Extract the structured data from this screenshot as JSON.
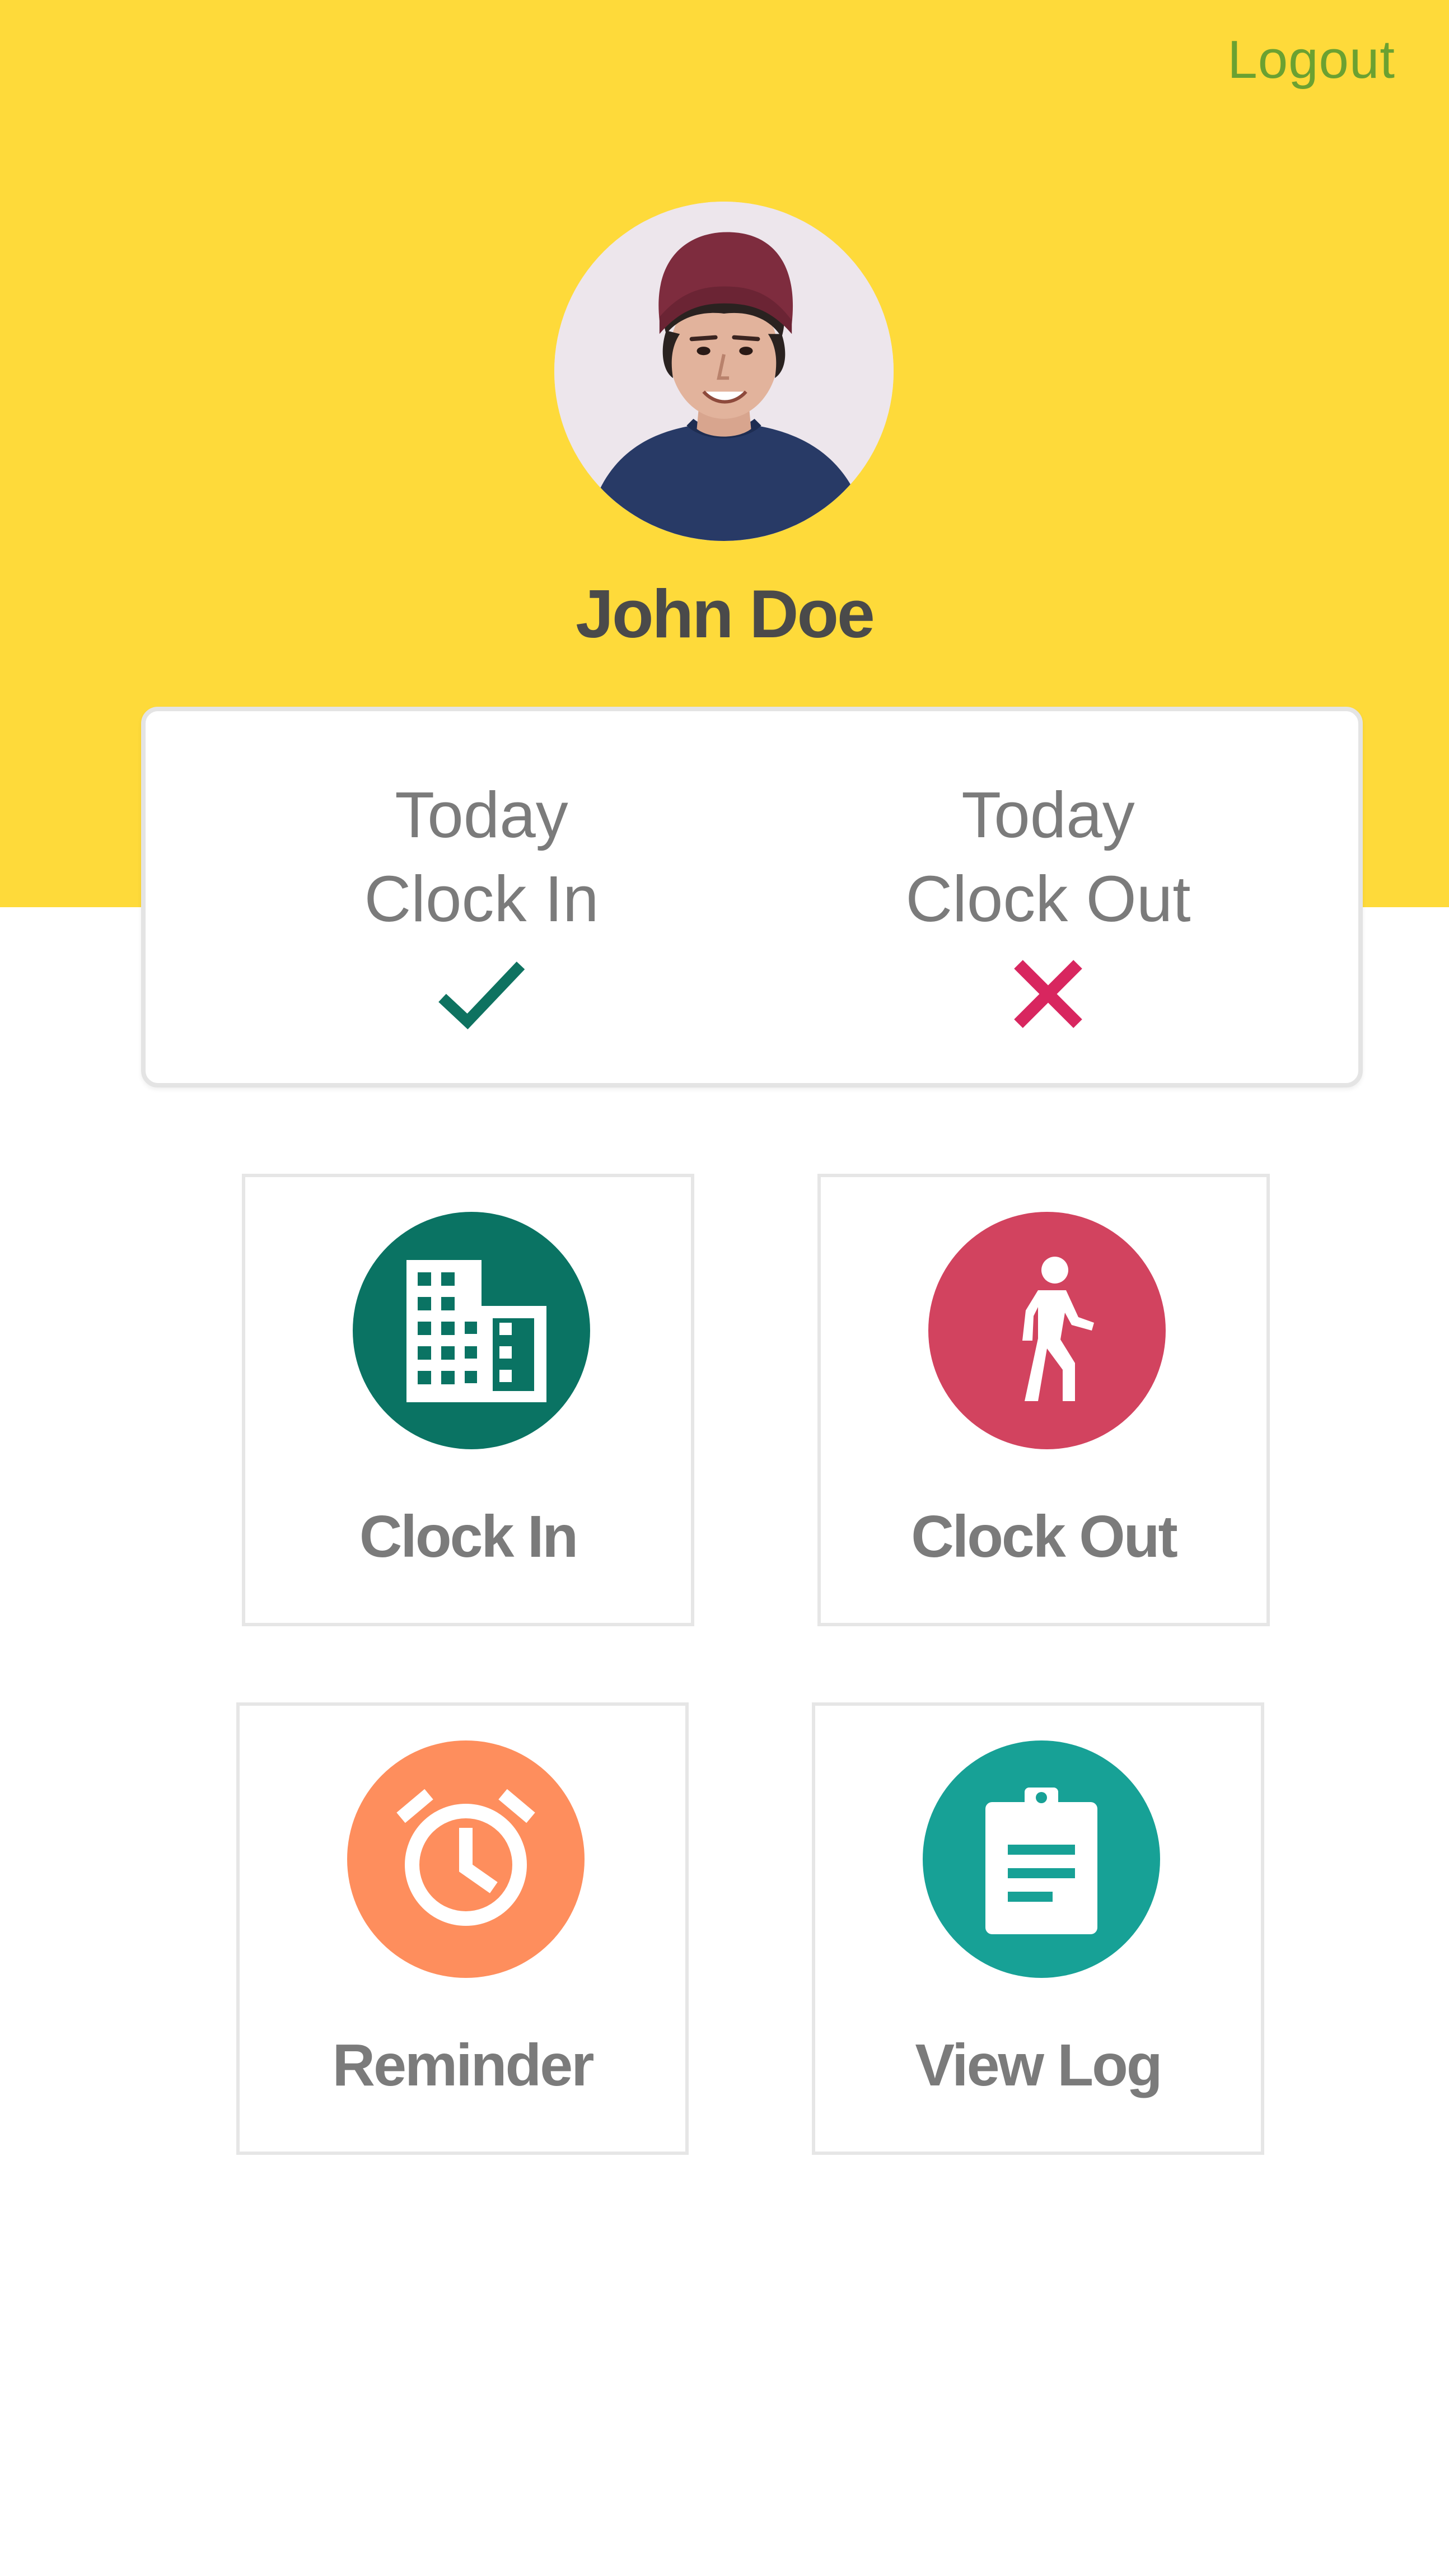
{
  "header": {
    "logout_label": "Logout",
    "background_color": "#FEDA3A",
    "logout_color": "#6BA131"
  },
  "profile": {
    "name": "John Doe",
    "avatar_icon": "user-photo"
  },
  "status": {
    "clock_in": {
      "line1": "Today",
      "line2": "Clock In",
      "state": "done",
      "icon": "check-icon",
      "color": "#0E7260"
    },
    "clock_out": {
      "line1": "Today",
      "line2": "Clock Out",
      "state": "not-done",
      "icon": "cross-icon",
      "color": "#D8265F"
    }
  },
  "actions": [
    {
      "label": "Clock In",
      "icon": "building-icon",
      "color": "#0A7363"
    },
    {
      "label": "Clock Out",
      "icon": "walking-person-icon",
      "color": "#D2435F"
    },
    {
      "label": "Reminder",
      "icon": "alarm-clock-icon",
      "color": "#FE8E5D"
    },
    {
      "label": "View Log",
      "icon": "clipboard-icon",
      "color": "#17A196"
    }
  ]
}
